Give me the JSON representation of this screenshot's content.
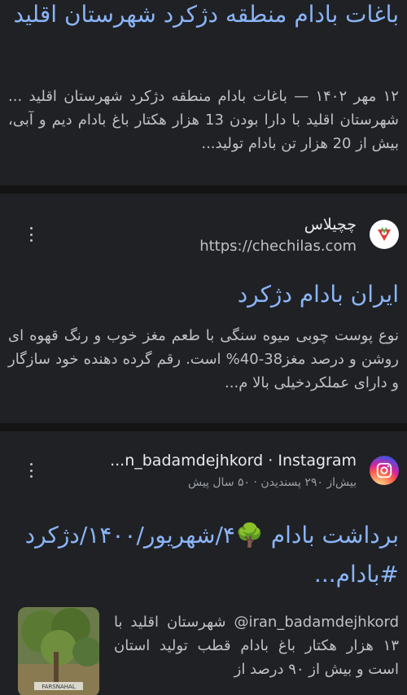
{
  "results": [
    {
      "title": "باغات بادام منطقه دژکرد شهرستان اقلید",
      "snippet": "۱۲ مهر ۱۴۰۲ — باغات بادام منطقه دژکرد شهرستان اقلید ... شهرستان اقلید با دارا بودن 13 هزار هکتار باغ بادام دیم و آبی، بیش از 20 هزار تن بادام تولید..."
    },
    {
      "source_name": "چچیلاس",
      "source_url": "https://chechilas.com",
      "favicon": "chechilas-logo-icon",
      "title": "ایران بادام دژکرد",
      "snippet": "نوع پوست چوبی میوه سنگی با طعم مغز خوب و رنگ قهوه ای روشن و درصد مغز38-40% است. رقم گرده دهنده خود سازگار و دارای عملکردخیلی بالا م..."
    },
    {
      "source_name": "n_badamdejhkord · Instagram...",
      "source_meta": "بیش‌از ۲۹۰ پسندیدن · ۵۰ سال پیش",
      "favicon": "instagram-icon",
      "title": "برداشت بادام 🌳۴/شهریور/۱۴۰۰/دژکرد #بادام...",
      "snippet": "iran_badamdejhkord@ شهرستان اقلید با ۱۳ هزار هکتار باغ بادام قطب تولید استان است و بیش از ۹۰ درصد از",
      "thumbnail": "almond-orchard-photo"
    }
  ],
  "colors": {
    "background": "#202124",
    "title_link": "#8ab4f8",
    "snippet_text": "#bdc1c6",
    "separator": "#141414"
  }
}
